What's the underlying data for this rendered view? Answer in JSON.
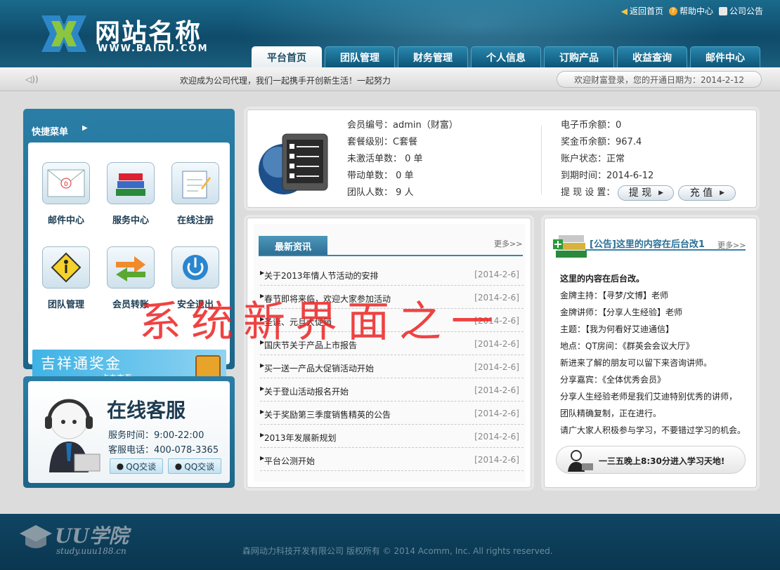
{
  "brand": {
    "title": "网站名称",
    "subtitle": "WWW.BAIDU.COM"
  },
  "toplinks": [
    {
      "label": "返回首页"
    },
    {
      "label": "帮助中心"
    },
    {
      "label": "公司公告"
    }
  ],
  "nav": [
    "平台首页",
    "团队管理",
    "财务管理",
    "个人信息",
    "订购产品",
    "收益查询",
    "邮件中心"
  ],
  "ticker": {
    "text": "欢迎成为公司代理，我们一起携手开创新生活！一起努力",
    "welcome": "欢迎财富登录，您的开通日期为：2014-2-12"
  },
  "quick_menu": {
    "title": "快捷菜单",
    "items": [
      "邮件中心",
      "服务中心",
      "在线注册",
      "团队管理",
      "会员转账",
      "安全退出"
    ],
    "banner_text": "吉祥通奖金",
    "banner_sub": "点击查看"
  },
  "service": {
    "title": "在线客服",
    "hours": "服务时间：9:00-22:00",
    "phone": "客服电话：400-078-3365",
    "qq_label": "QQ交谈"
  },
  "member": {
    "left": [
      "会员编号：admin（财富）",
      "套餐级别：C套餐",
      "未激活单数： 0 单",
      "带动单数： 0 单",
      "团队人数： 9 人"
    ],
    "right": [
      "电子币余额：0",
      "奖金币余额：967.4",
      "账户状态：正常",
      "到期时间：2014-6-12"
    ],
    "withdraw_label": "提 现 设 置：",
    "withdraw_btn": "提 现",
    "recharge_btn": "充 值"
  },
  "news": {
    "title": "最新资讯",
    "more": "更多>>",
    "items": [
      {
        "title": "关于2013年情人节活动的安排",
        "date": "[2014-2-6]"
      },
      {
        "title": "春节即将来临，欢迎大家参加活动",
        "date": "[2014-2-6]"
      },
      {
        "title": "圣诞、元旦大促销",
        "date": "[2014-2-6]"
      },
      {
        "title": "国庆节关于产品上市报告",
        "date": "[2014-2-6]"
      },
      {
        "title": "买一送一产品大促销活动开始",
        "date": "[2014-2-6]"
      },
      {
        "title": "关于登山活动报名开始",
        "date": "[2014-2-6]"
      },
      {
        "title": "关于奖励第三季度销售精英的公告",
        "date": "[2014-2-6]"
      },
      {
        "title": "2013年发展新规划",
        "date": "[2014-2-6]"
      },
      {
        "title": "平台公测开始",
        "date": "[2014-2-6]"
      }
    ]
  },
  "notice": {
    "title": "[公告]这里的内容在后台改1",
    "more": "更多>>",
    "lines": [
      "这里的内容在后台改。",
      "金牌主持：【寻梦/文博】老师",
      "金牌讲师：【分享人生经验】老师",
      "主题：【我为何看好艾迪通信】",
      "地点：QT房间：《群英会会议大厅》",
      "新进来了解的朋友可以留下来咨询讲师。",
      "分享嘉宾：《全体优秀会员》",
      "分享人生经验老师是我们艾迪特别优秀的讲师，",
      "团队精确复制，正在进行。",
      "请广大家人积极参与学习，不要错过学习的机会。"
    ],
    "study": "一三五晚上8:30分进入学习天地!"
  },
  "footer": {
    "copyright": "森网动力科技开发有限公司   版权所有   © 2014 Acomm, Inc. All rights reserved.",
    "uu": "UU学院",
    "uu_sub": "study.uuu188.cn"
  },
  "watermark": "系统新界面之一",
  "colors": {
    "header": "#0f4b6a",
    "accent": "#2a7ea6",
    "watermark": "#e22222"
  }
}
